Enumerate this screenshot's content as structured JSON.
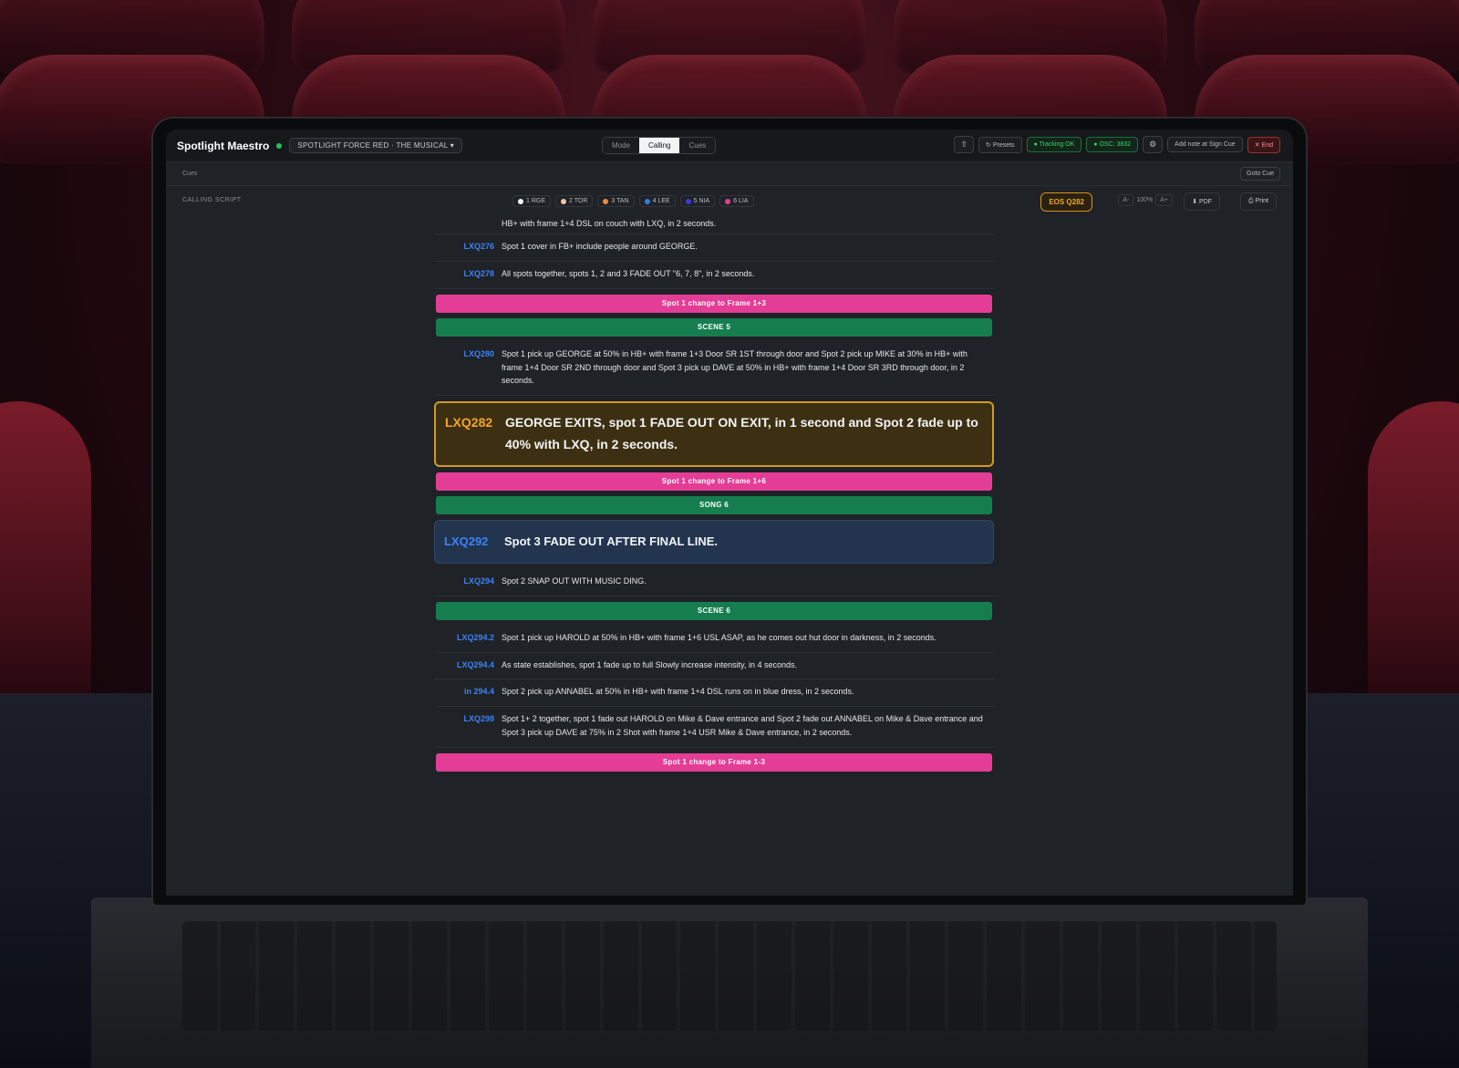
{
  "app": {
    "title": "Spotlight Maestro",
    "show_select": "SPOTLIGHT FORCE RED · THE MUSICAL",
    "modes": [
      "Mode",
      "Calling",
      "Cues"
    ],
    "active_mode": "Calling",
    "tools": {
      "presets": "Presets",
      "tracking": "Tracking OK",
      "osc": "OSC: 3832",
      "add_note": "Add note at Sign Cue",
      "end": "End"
    },
    "accent_colors": {
      "live": "#22c55e",
      "current": "#d29a22",
      "cue_id": "#3b82f6",
      "pink": "#e43d96",
      "green": "#167d4f"
    }
  },
  "subbar": {
    "left": "Cues",
    "goto": "Goto Cue"
  },
  "toolbar": {
    "calling_label": "CALLING SCRIPT",
    "spots": [
      {
        "label": "1 RGE",
        "color": "#f5f5f5"
      },
      {
        "label": "2 TOR",
        "color": "#f4c7a1"
      },
      {
        "label": "3 TAN",
        "color": "#f08a3c"
      },
      {
        "label": "4 LEE",
        "color": "#2f7de1"
      },
      {
        "label": "5 NIA",
        "color": "#3b3bdb"
      },
      {
        "label": "6 LIA",
        "color": "#e43d96"
      }
    ],
    "cue_status": "EOS Q282",
    "zoom": {
      "minus": "A-",
      "value": "100%",
      "plus": "A+"
    },
    "pdf": "PDF",
    "print": "Print"
  },
  "script": {
    "top_partial": "HB+ with frame 1+4 DSL on couch with LXQ, in 2 seconds.",
    "block1": [
      {
        "id": "LXQ276",
        "text": "Spot 1 cover in FB+ include people around GEORGE."
      },
      {
        "id": "LXQ278",
        "text": "All spots together, spots 1, 2 and 3 FADE OUT \"6, 7, 8\", in 2 seconds."
      }
    ],
    "banner1": "Spot 1 change to Frame 1+3",
    "scene5": "SCENE 5",
    "lxq280": {
      "id": "LXQ280",
      "text": "Spot 1 pick up GEORGE at 50% in HB+ with frame 1+3 Door SR 1ST through door and Spot 2 pick up MIKE at 30% in HB+ with frame 1+4 Door SR 2ND through door and Spot 3 pick up DAVE at 50% in HB+ with frame 1+4 Door SR 3RD through door, in 2 seconds."
    },
    "current": {
      "id": "LXQ282",
      "text": "GEORGE EXITS, spot 1 FADE OUT ON EXIT, in 1 second and Spot 2 fade up to 40% with LXQ, in 2 seconds."
    },
    "banner2": "Spot 1 change to Frame 1+6",
    "song6": "SONG 6",
    "next": {
      "id": "LXQ292",
      "text": "Spot 3 FADE OUT AFTER FINAL LINE."
    },
    "lxq294": {
      "id": "LXQ294",
      "text": "Spot 2 SNAP OUT WITH MUSIC DING."
    },
    "scene6": "SCENE 6",
    "block2": [
      {
        "id": "LXQ294.2",
        "text": "Spot 1 pick up HAROLD at 50% in HB+ with frame 1+6 USL ASAP, as he comes out hut door in darkness, in 2 seconds."
      },
      {
        "id": "LXQ294.4",
        "text": "As state establishes, spot 1 fade up to full Slowly increase intensity, in 4 seconds."
      },
      {
        "id": "in 294.4",
        "text": "Spot 2 pick up ANNABEL at 50% in HB+ with frame 1+4 DSL runs on in blue dress, in 2 seconds."
      },
      {
        "id": "LXQ298",
        "text": "Spot 1+ 2 together, spot 1 fade out HAROLD on Mike & Dave entrance and Spot 2 fade out ANNABEL on Mike & Dave entrance and Spot 3 pick up DAVE at 75% in 2 Shot with frame 1+4 USR Mike & Dave entrance, in 2 seconds."
      }
    ],
    "banner3": "Spot 1 change to Frame 1-3"
  }
}
